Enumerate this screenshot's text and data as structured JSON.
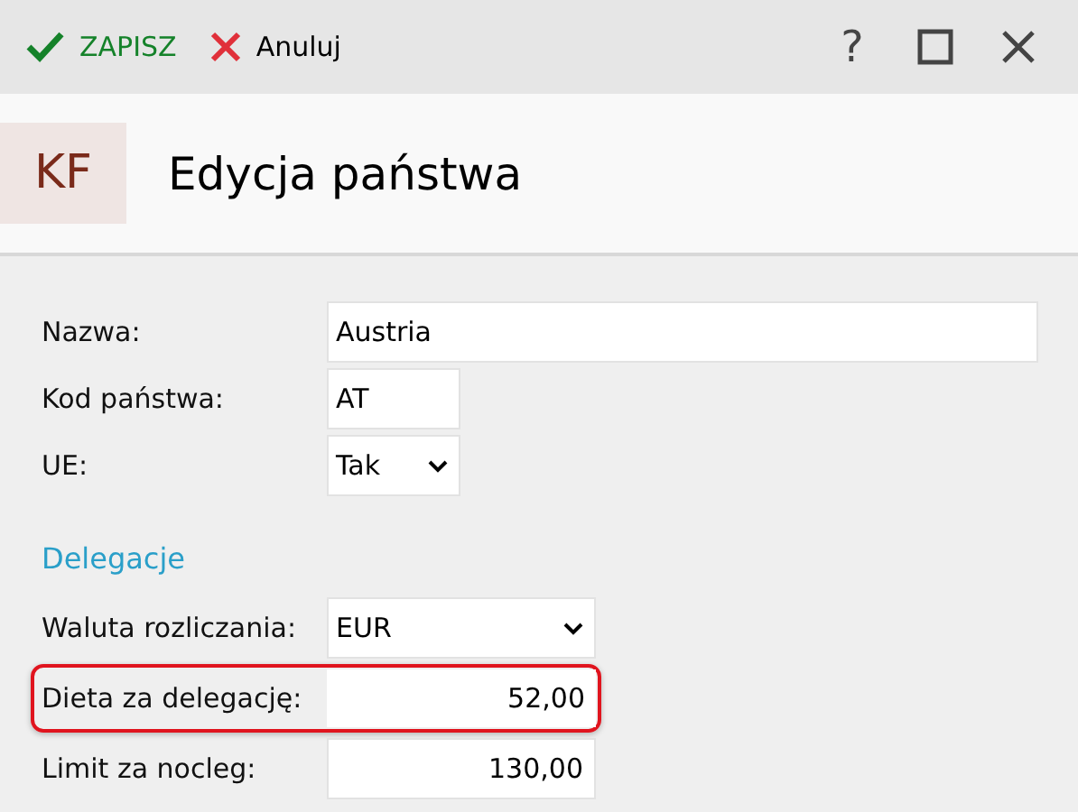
{
  "toolbar": {
    "save": "ZAPISZ",
    "cancel": "Anuluj",
    "help": "?"
  },
  "header": {
    "badge": "KF",
    "title": "Edycja państwa"
  },
  "sections": [
    {
      "rows": [
        {
          "label": "Nazwa:",
          "value": "Austria",
          "kind": "text",
          "highlighted": false
        },
        {
          "label": "Kod państwa:",
          "value": "AT",
          "kind": "code",
          "highlighted": false
        },
        {
          "label": "UE:",
          "value": "Tak",
          "kind": "select",
          "highlighted": false
        }
      ]
    },
    {
      "heading": "Delegacje",
      "rows": [
        {
          "label": "Waluta rozliczania:",
          "value": "EUR",
          "kind": "select-wide",
          "highlighted": false
        },
        {
          "label": "Dieta za delegację:",
          "value": "52,00",
          "kind": "amount",
          "highlighted": true
        },
        {
          "label": "Limit za nocleg:",
          "value": "130,00",
          "kind": "amount",
          "highlighted": false
        }
      ]
    }
  ]
}
